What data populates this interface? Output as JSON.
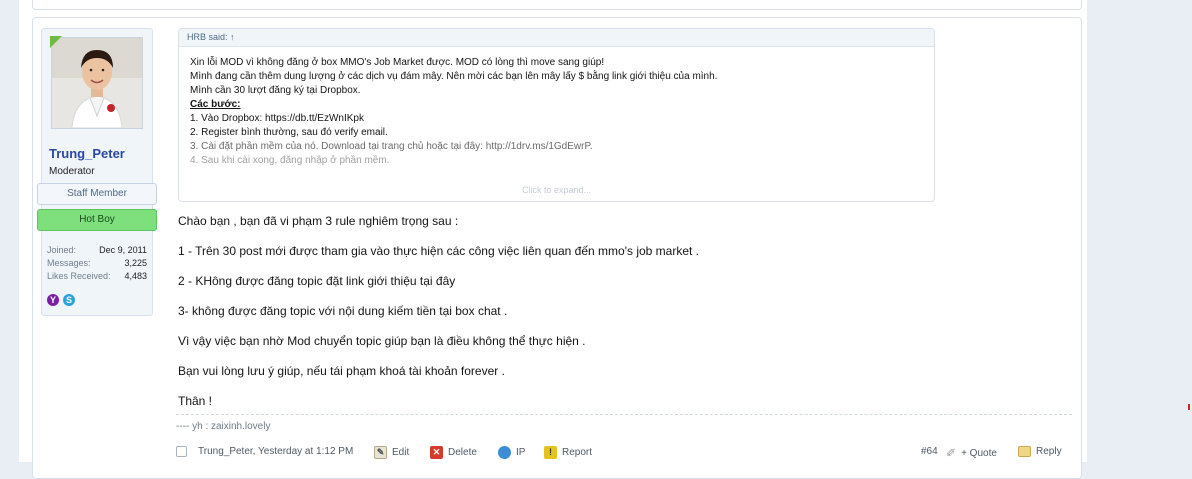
{
  "user": {
    "name": "Trung_Peter",
    "title": "Moderator",
    "banners": [
      "Staff Member",
      "Hot Boy"
    ],
    "stats": [
      {
        "label": "Joined:",
        "value": "Dec 9, 2011"
      },
      {
        "label": "Messages:",
        "value": "3,225"
      },
      {
        "label": "Likes Received:",
        "value": "4,483"
      }
    ],
    "contact_icons": [
      "yahoo-icon",
      "skype-icon"
    ]
  },
  "quote": {
    "header": "HRB said: ↑",
    "lines": [
      "Xin lỗi MOD vì không đăng ở box MMO's Job Market được. MOD có lòng thì move sang giúp!",
      "Mình đang cần thêm dung lượng ở các dịch vụ đám mây. Nên mời các bạn lên mây lấy $ bằng link giới thiệu của mình.",
      "Mình cần 30 lượt đăng ký tại Dropbox.",
      "Các bước:",
      "1. Vào Dropbox: https://db.tt/EzWnIKpk",
      "2. Register bình thường, sau đó verify email.",
      "3. Cài đặt phần mềm của nó. Download tại trang chủ hoặc tại đây: http://1drv.ms/1GdEwrP.",
      "4. Sau khi cài xong, đăng nhập ở phần mềm."
    ],
    "expand_label": "Click to expand..."
  },
  "message": {
    "paragraphs": [
      "Chào bạn , bạn đã vi phạm 3 rule nghiêm trọng sau :",
      "1 - Trên 30 post mới được tham gia vào thực hiện các công việc liên quan đến mmo's job market .",
      "2 - KHông được đăng topic đặt link giới thiệu tại đây",
      "3- không được đăng topic với nội dung kiếm tiền tại box chat .",
      "Vì vậy việc bạn nhờ Mod chuyển topic giúp bạn là điều không thể thực hiện .",
      "Bạn vui lòng lưu ý giúp, nếu tái phạm khoá tài khoản forever .",
      "Thân !"
    ],
    "signature": "---- yh : zaixinh.lovely"
  },
  "footer": {
    "author_date": "Trung_Peter, Yesterday at 1:12 PM",
    "edit": "Edit",
    "delete": "Delete",
    "ip": "IP",
    "report": "Report",
    "post_number": "#64",
    "quote": "+ Quote",
    "reply": "Reply"
  },
  "colors": {
    "username": "#2b48a5",
    "hot_boy_banner": "#7ee07c",
    "page_background": "#e9eef4"
  }
}
